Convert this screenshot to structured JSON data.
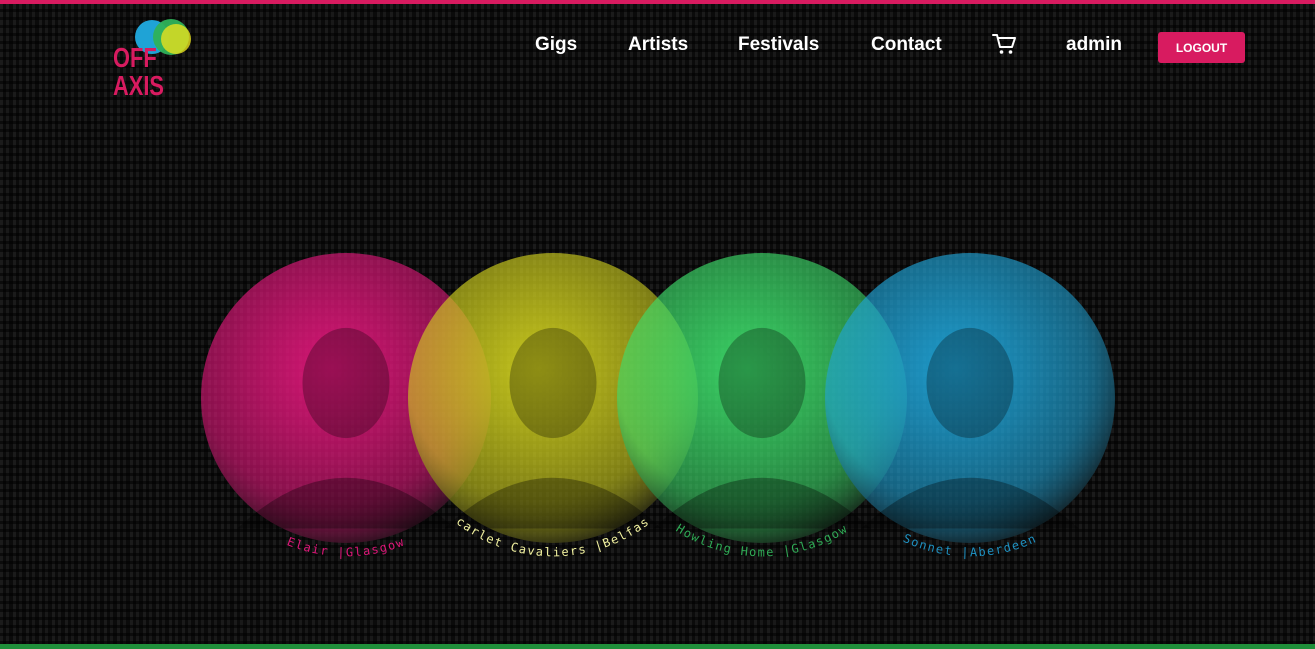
{
  "colors": {
    "brand_pink": "#d81b60",
    "green_bar": "#1f8f3a",
    "pink": "#e0177a",
    "yellow": "#cfcf1e",
    "green": "#3ddc6a",
    "blue": "#1fa3d6"
  },
  "header": {
    "logo_text": "OFF AXIS",
    "nav": [
      {
        "label": "Gigs"
      },
      {
        "label": "Artists"
      },
      {
        "label": "Festivals"
      },
      {
        "label": "Contact"
      }
    ],
    "cart_icon": "shopping-cart-icon",
    "username": "admin",
    "logout_label": "LOGOUT"
  },
  "artists": [
    {
      "name": "Elair",
      "city": "Glasgow",
      "label": "Elair |Glasgow",
      "color": "#e0177a",
      "label_color": "#e0177a"
    },
    {
      "name": "Scarlet Cavaliers",
      "city": "Belfast",
      "label": "Scarlet Cavaliers |Belfast",
      "color": "#cfcf1e",
      "label_color": "#f2f2a0"
    },
    {
      "name": "Howling Home",
      "city": "Glasgow",
      "label": "Howling Home |Glasgow",
      "color": "#3ddc6a",
      "label_color": "#2faa55"
    },
    {
      "name": "Sonnet",
      "city": "Aberdeen",
      "label": "Sonnet |Aberdeen",
      "color": "#1fa3d6",
      "label_color": "#1e90c0"
    }
  ]
}
